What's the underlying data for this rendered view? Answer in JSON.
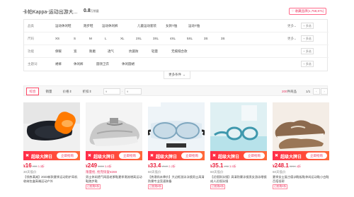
{
  "header": {
    "shop_name": "卡帕Kappa-运动出游大...",
    "sales_value": "0.8",
    "sales_unit": "万销量",
    "fav_button": "收藏品牌(1,758,871)",
    "fav_icon": "heart-icon"
  },
  "filters": [
    {
      "label": "品类",
      "options": [
        "运动休闲鞋",
        "跑步鞋",
        "运动休闲裤",
        "儿童运动套装",
        "女款T恤",
        "运动T恤"
      ],
      "more": "更多",
      "multi": "+ 多选"
    },
    {
      "label": "尺码",
      "options": [
        "XS",
        "S",
        "M",
        "L",
        "XL",
        "2XL",
        "3XL",
        "4XL",
        "5XL",
        "3S",
        "3S"
      ],
      "more": "更多",
      "multi": "+ 多选"
    },
    {
      "label": "功能",
      "options": [
        "保暖",
        "宽",
        "耐磨",
        "透气",
        "抗菌防",
        "轻量",
        "无痕缝合款"
      ],
      "more": "",
      "multi": "+ 多选"
    },
    {
      "label": "主题词",
      "options": [
        "裙裤",
        "休闲裤",
        "圆领卫衣",
        "休闲圆裙"
      ],
      "more": "",
      "multi": "+ 多选"
    }
  ],
  "more_filter": "更多条件",
  "sortbar": {
    "tabs": [
      "综合",
      "销量",
      "价格",
      "折扣"
    ],
    "price_min_placeholder": "¥",
    "price_max_placeholder": "¥",
    "total_count": "200",
    "total_suffix": "件商品",
    "page": "1/1",
    "prev": "‹",
    "next": "›"
  },
  "products": [
    {
      "banner": "超级大牌日",
      "banner_btn": "立即抢购",
      "tag": "",
      "currency": "¥",
      "price": "16",
      "old_price": "¥33",
      "discount": "3.3折",
      "sub": "30天低价",
      "sub_red": false,
      "desc": "【领券满减】2023新款夏季运动防护耳机收纳包盒高端运动户外",
      "extra": "",
      "extra_badge": ""
    },
    {
      "banner": "超级大牌日",
      "banner_btn": "立即抢购",
      "tag": "",
      "currency": "¥",
      "price": "249",
      "old_price": "¥659",
      "discount": "3.8折",
      "sub": "限量抢, 抢完恢复¥269",
      "sub_red": true,
      "desc": "男士休闲透气网面老爹鞋夏季潮流增高运动鞋跑步鞋",
      "extra": "",
      "extra_badge": "已抢购5折"
    },
    {
      "banner": "超级大牌日",
      "banner_btn": "立即抢购",
      "tag": "",
      "currency": "¥",
      "price": "33.4",
      "old_price": "¥149",
      "discount": "2.2折",
      "sub": "60天低价",
      "sub_red": false,
      "desc": "【热潮尚未降价】大边框游泳泳镜男士高清防雾专业竞速装备",
      "extra": "",
      "extra_badge": "已抢购8折"
    },
    {
      "banner": "超级大牌日",
      "banner_btn": "立即抢购",
      "tag": "",
      "currency": "¥",
      "price": "35.1",
      "old_price": "¥98",
      "discount": "3.5折",
      "sub": "60天低价",
      "sub_red": false,
      "desc": "【近视款泳镜】高清防雾泳镜男女游泳眼镜成人近视泳镜",
      "extra": "",
      "extra_badge": "已抢购6折"
    },
    {
      "banner": "超级大牌日",
      "banner_btn": "立即抢购",
      "tag": "",
      "currency": "¥",
      "price": "248.1",
      "old_price": "¥614",
      "discount": "4折",
      "sub": "60天低价",
      "sub_red": false,
      "desc": "夏季女士复古德训鞋板鞋休闲运动鞋小白鞋百搭低帮",
      "extra": "",
      "extra_badge": "已抢购5折"
    }
  ]
}
